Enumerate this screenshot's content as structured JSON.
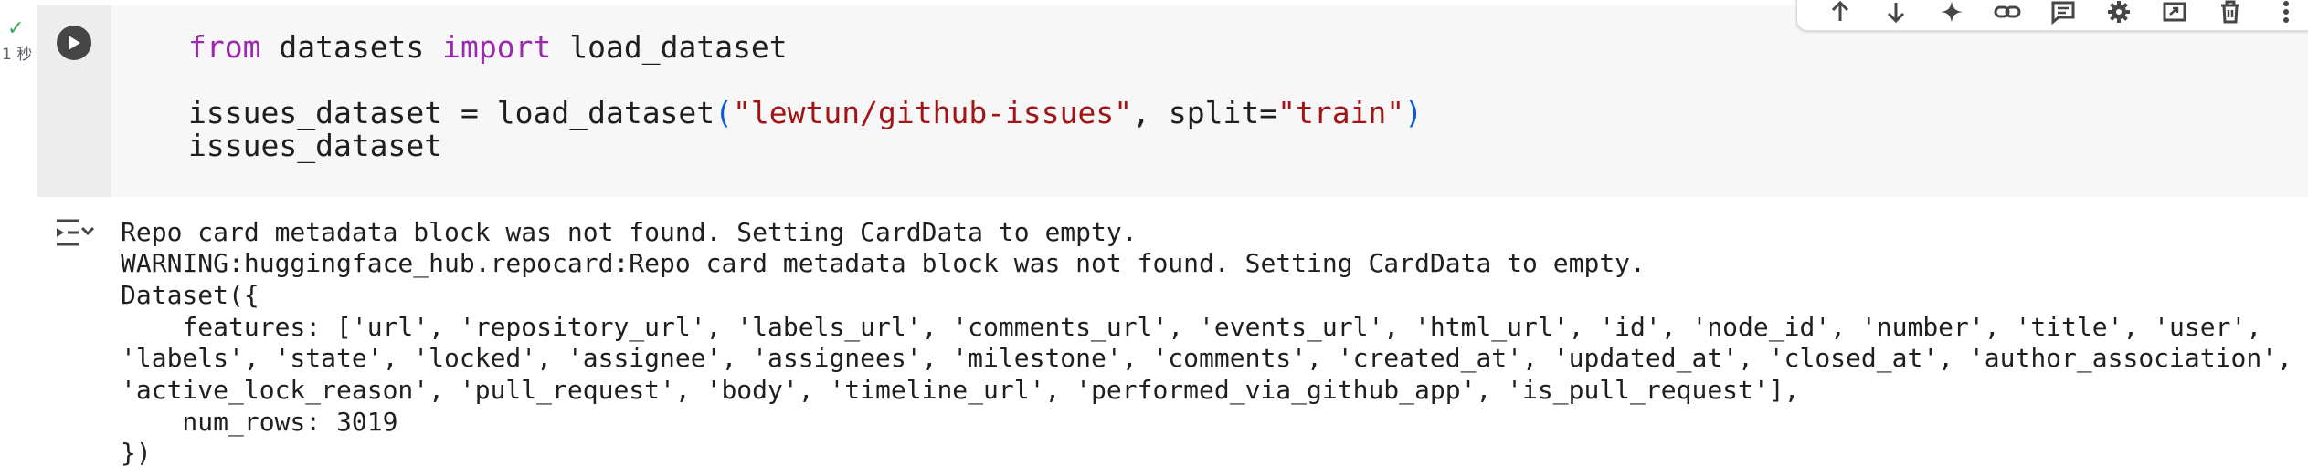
{
  "cell": {
    "status": {
      "check_glyph": "✓",
      "exec_time": "1 秒"
    },
    "run_button_icon": "play-icon",
    "code": {
      "line1": {
        "kw1": "from",
        "mid": " datasets ",
        "kw2": "import",
        "rest": " load_dataset"
      },
      "line3": {
        "pre": "issues_dataset = load_dataset",
        "open": "(",
        "str1": "\"lewtun/github-issues\"",
        "mid": ", split=",
        "str2": "\"train\"",
        "close": ")"
      },
      "line4": "issues_dataset"
    },
    "toolbar_icons": [
      "move-up-icon",
      "move-down-icon",
      "gemini-sparkle-icon",
      "link-icon",
      "comment-icon",
      "settings-gear-icon",
      "open-in-tab-icon",
      "delete-icon",
      "more-vert-icon"
    ],
    "output": {
      "toggle_icon": "output-collapse-icon",
      "lines": [
        "Repo card metadata block was not found. Setting CardData to empty.",
        "WARNING:huggingface_hub.repocard:Repo card metadata block was not found. Setting CardData to empty.",
        "Dataset({",
        "    features: ['url', 'repository_url', 'labels_url', 'comments_url', 'events_url', 'html_url', 'id', 'node_id', 'number', 'title', 'user',",
        "'labels', 'state', 'locked', 'assignee', 'assignees', 'milestone', 'comments', 'created_at', 'updated_at', 'closed_at', 'author_association',",
        "'active_lock_reason', 'pull_request', 'body', 'timeline_url', 'performed_via_github_app', 'is_pull_request'],",
        "    num_rows: 3019",
        "})"
      ]
    }
  },
  "colors": {
    "keyword": "#9c27b0",
    "string": "#a31515",
    "paren": "#0d5bd7",
    "check": "#34a853",
    "code_bg": "#f7f7f7"
  }
}
